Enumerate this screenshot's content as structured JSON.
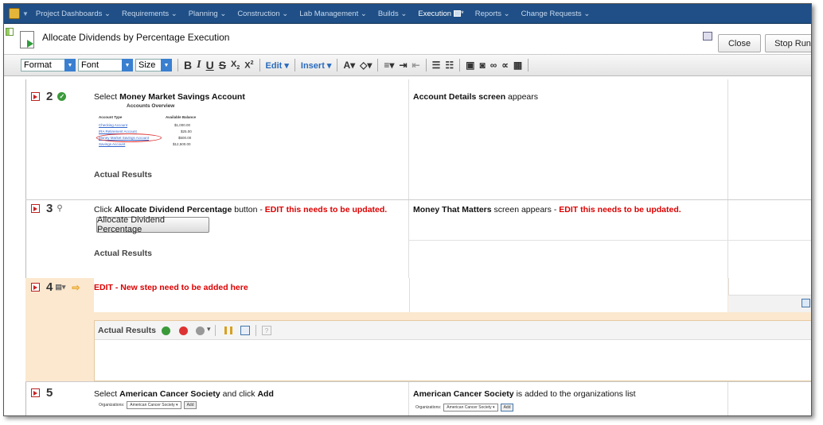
{
  "nav": {
    "items": [
      "Project Dashboards",
      "Requirements",
      "Planning",
      "Construction",
      "Lab Management",
      "Builds",
      "Execution",
      "Reports",
      "Change Requests"
    ],
    "active": "Execution",
    "asterisk": "*"
  },
  "titlebar": {
    "title": "Allocate Dividends by Percentage Execution",
    "close_label": "Close",
    "stop_label": "Stop Run"
  },
  "toolbar": {
    "format": "Format",
    "font": "Font",
    "size": "Size",
    "edit": "Edit",
    "insert": "Insert"
  },
  "steps": [
    {
      "number": "2",
      "action_prefix": "Select ",
      "action_bold": "Money Market Savings Account",
      "expected_bold": "Account Details screen",
      "expected_suffix": " appears",
      "actual_label": "Actual Results",
      "mock": {
        "title": "Accounts Overview",
        "col1": "Account Type",
        "col2": "Available Balance",
        "rows": [
          {
            "name": "Checking Account",
            "value": "$1,000.00"
          },
          {
            "name": "IRA Retirement Account",
            "value": "$25.00"
          },
          {
            "name": "Money Market Savings Account",
            "value": "$500.00"
          },
          {
            "name": "Savings Account",
            "value": "$12,500.00"
          }
        ]
      }
    },
    {
      "number": "3",
      "action_prefix": "Click ",
      "action_bold": "Allocate Dividend Percentage",
      "action_suffix": " button - ",
      "action_edit": "EDIT this needs to be updated.",
      "button_label": "Allocate Dividend Percentage",
      "expected_bold": "Money That Matters",
      "expected_suffix": " screen appears - ",
      "expected_edit": "EDIT this needs to be updated.",
      "actual_label": "Actual Results"
    },
    {
      "number": "4",
      "action_edit": "EDIT - New step need to be added here",
      "actual_label": "Actual Results"
    },
    {
      "number": "5",
      "action_prefix": "Select ",
      "action_bold": "American Cancer Society",
      "action_mid": " and click ",
      "action_bold2": "Add",
      "expected_bold": "American Cancer Society",
      "expected_suffix": " is added to the organizations list",
      "org_label": "Organizations:",
      "org_value": "American Cancer Society",
      "add_label": "Add"
    }
  ],
  "colors": {
    "nav_bg": "#1f4f86",
    "edit_red": "#dd0000",
    "row_highlight": "#fbe8cf",
    "link_blue": "#3366cc"
  }
}
